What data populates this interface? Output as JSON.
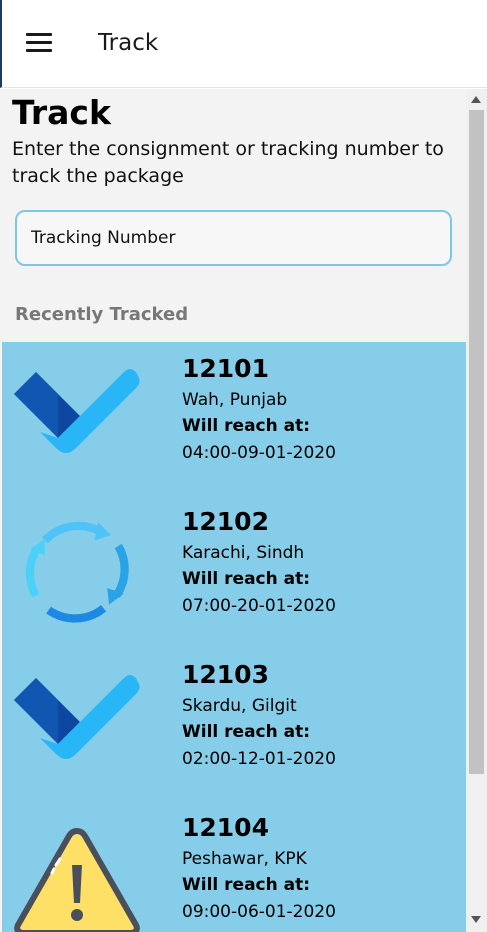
{
  "appbar": {
    "title": "Track"
  },
  "page": {
    "title": "Track",
    "subtitle": "Enter the consignment or tracking number to track the package"
  },
  "search": {
    "placeholder": "Tracking Number",
    "value": ""
  },
  "recent": {
    "label": "Recently Tracked",
    "items": [
      {
        "id": "12101",
        "location": "Wah, Punjab",
        "reach_label": "Will reach at:",
        "reach_time": "04:00-09-01-2020",
        "status_icon": "check-icon"
      },
      {
        "id": "12102",
        "location": "Karachi, Sindh",
        "reach_label": "Will reach at:",
        "reach_time": "07:00-20-01-2020",
        "status_icon": "sync-icon"
      },
      {
        "id": "12103",
        "location": "Skardu, Gilgit",
        "reach_label": "Will reach at:",
        "reach_time": "02:00-12-01-2020",
        "status_icon": "check-icon"
      },
      {
        "id": "12104",
        "location": "Peshawar, KPK",
        "reach_label": "Will reach at:",
        "reach_time": "09:00-06-01-2020",
        "status_icon": "warning-icon"
      }
    ]
  },
  "colors": {
    "list_background": "#86cde9",
    "search_border": "#7cc8e6",
    "check_dark": "#0d47a1",
    "check_light": "#29b6f6",
    "warning_fill": "#ffe066"
  }
}
